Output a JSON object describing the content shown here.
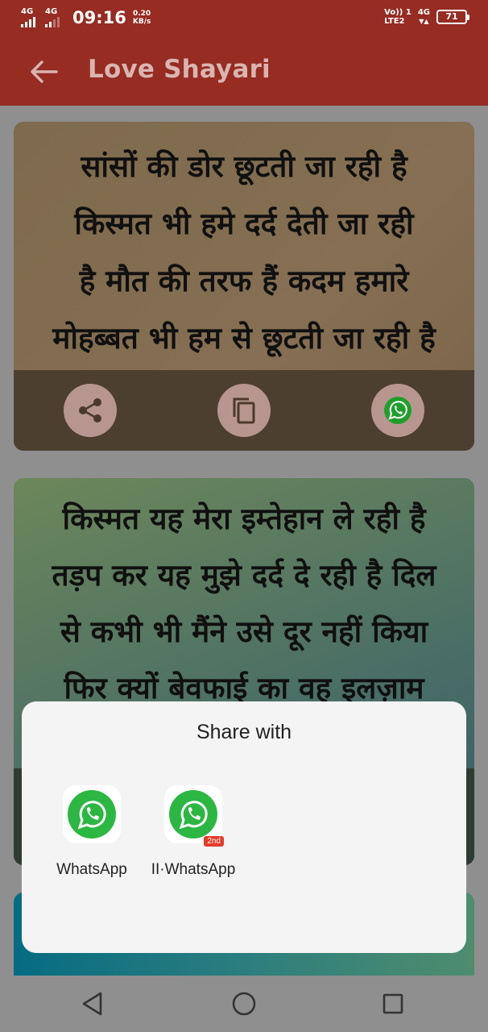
{
  "status_bar": {
    "net1": "4G",
    "net2": "4G",
    "time": "09:16",
    "speed_value": "0.20",
    "speed_unit": "KB/s",
    "volte": "Vo)) 1",
    "lte": "LTE2",
    "net3": "4G",
    "battery": "71"
  },
  "app_bar": {
    "title": "Love Shayari",
    "back_icon": "arrow-left-icon"
  },
  "cards": [
    {
      "text": "सांसों की डोर छूटती जा रही है\nकिस्मत भी हमे दर्द देती जा रही\nहै मौत की तरफ हैं कदम हमारे\nमोहब्बत भी हम से छूटती जा रही है",
      "actions": [
        "share-icon",
        "copy-icon",
        "whatsapp-icon"
      ]
    },
    {
      "text": "किस्मत यह मेरा इम्तेहान ले रही है\nतड़प कर यह मुझे दर्द दे रही है दिल\nसे कभी भी मैंने उसे दूर नहीं किया\nफिर क्यों बेवफाई का वह इलज़ाम",
      "actions": [
        "share-icon",
        "copy-icon",
        "whatsapp-icon"
      ]
    }
  ],
  "share_sheet": {
    "title": "Share with",
    "apps": [
      {
        "label": "WhatsApp",
        "icon": "whatsapp-icon",
        "badge": ""
      },
      {
        "label": "II·WhatsApp",
        "icon": "whatsapp-icon",
        "badge": "2nd"
      }
    ]
  },
  "nav_bar": {
    "buttons": [
      "back-triangle-icon",
      "home-circle-icon",
      "recents-square-icon"
    ]
  },
  "colors": {
    "app_bar": "#962c22",
    "title_text": "#d9b5b0",
    "action_button": "#b89690",
    "whatsapp_green": "#2bb742"
  }
}
